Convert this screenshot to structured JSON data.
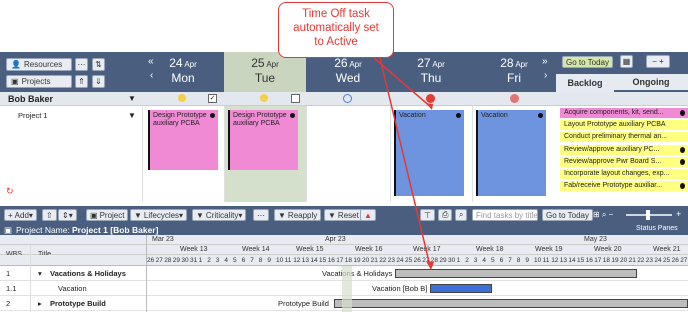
{
  "callout": {
    "lines": [
      "Time Off task",
      "automatically set",
      "to Active"
    ]
  },
  "resources_panel": {
    "resources_label": "Resources",
    "projects_label": "Projects"
  },
  "days": [
    {
      "num": "24",
      "mon": "Apr",
      "name": "Mon"
    },
    {
      "num": "25",
      "mon": "Apr",
      "name": "Tue"
    },
    {
      "num": "26",
      "mon": "Apr",
      "name": "Wed"
    },
    {
      "num": "27",
      "mon": "Apr",
      "name": "Thu"
    },
    {
      "num": "28",
      "mon": "Apr",
      "name": "Fri"
    }
  ],
  "controls": {
    "go_to_today": "Go to Today",
    "tab_backlog": "Backlog",
    "tab_ongoing": "Ongoing"
  },
  "resource": {
    "name": "Bob Baker",
    "project": "Project 1"
  },
  "cards": [
    {
      "text": "Design Prototype auxiliary PCBA",
      "color": "#f08ad4"
    },
    {
      "text": "Design Prototype auxiliary PCBA",
      "color": "#f08ad4"
    },
    {
      "text": "Vacation",
      "color": "#6f94df"
    },
    {
      "text": "Vacation",
      "color": "#6f94df"
    }
  ],
  "ongoing_tasks": [
    {
      "text": "Acquire components, kit, send...",
      "color": "#f08ad4"
    },
    {
      "text": "Layout Prototype auxiliary PCBA",
      "color": "#ffff80"
    },
    {
      "text": "Conduct preliminary thermal an...",
      "color": "#ffff80"
    },
    {
      "text": "Review/approve auxiliary PC...",
      "color": "#ffff80"
    },
    {
      "text": "Review/approve Pwr Board S...",
      "color": "#ffff80"
    },
    {
      "text": "Incorporate layout changes, exp...",
      "color": "#ffff80"
    },
    {
      "text": "Fab/receive Prototype auxiliar...",
      "color": "#ffff80"
    }
  ],
  "gantt_toolbar": {
    "add": "Add",
    "project": "Project",
    "lifecycles": "Lifecycles",
    "criticality": "Criticality",
    "reapply": "Reapply",
    "reset": "Reset",
    "search_placeholder": "Find tasks by title",
    "go_to_today": "Go to Today"
  },
  "project_bar": {
    "label": "Project Name:",
    "name": "Project 1 [Bob Baker]",
    "status_panes": "Status Panes"
  },
  "gantt_header": {
    "months": [
      "Mar 23",
      "Apr 23",
      "May 23"
    ],
    "weeks": [
      "Week 13",
      "Week 14",
      "Week 15",
      "Week 16",
      "Week 17",
      "Week 18",
      "Week 19",
      "Week 20",
      "Week 21"
    ],
    "days": [
      "26",
      "27",
      "28",
      "29",
      "30",
      "31",
      "1",
      "2",
      "3",
      "4",
      "5",
      "6",
      "7",
      "8",
      "9",
      "10",
      "11",
      "12",
      "13",
      "14",
      "15",
      "16",
      "17",
      "18",
      "19",
      "20",
      "21",
      "22",
      "23",
      "24",
      "25",
      "26",
      "27",
      "28",
      "29",
      "30",
      "1",
      "2",
      "3",
      "4",
      "5",
      "6",
      "7",
      "8",
      "9",
      "10",
      "11",
      "12",
      "13",
      "14",
      "15",
      "16",
      "17",
      "18",
      "19",
      "20",
      "21",
      "22",
      "23",
      "24",
      "25",
      "26",
      "27",
      "28"
    ],
    "col_wbs": "WBS",
    "col_title": "Title"
  },
  "gantt_rows": [
    {
      "wbs": "1",
      "title": "Vacations & Holidays",
      "bar_label": "Vacations & Holidays"
    },
    {
      "wbs": "1.1",
      "title": "Vacation",
      "bar_label": "Vacation [Bob B]"
    },
    {
      "wbs": "2",
      "title": "Prototype Build",
      "bar_label": "Prototype Build"
    }
  ],
  "colors": {
    "header": "#4a5f80",
    "active_day": "#c9d5bf",
    "callout": "#e53935"
  }
}
